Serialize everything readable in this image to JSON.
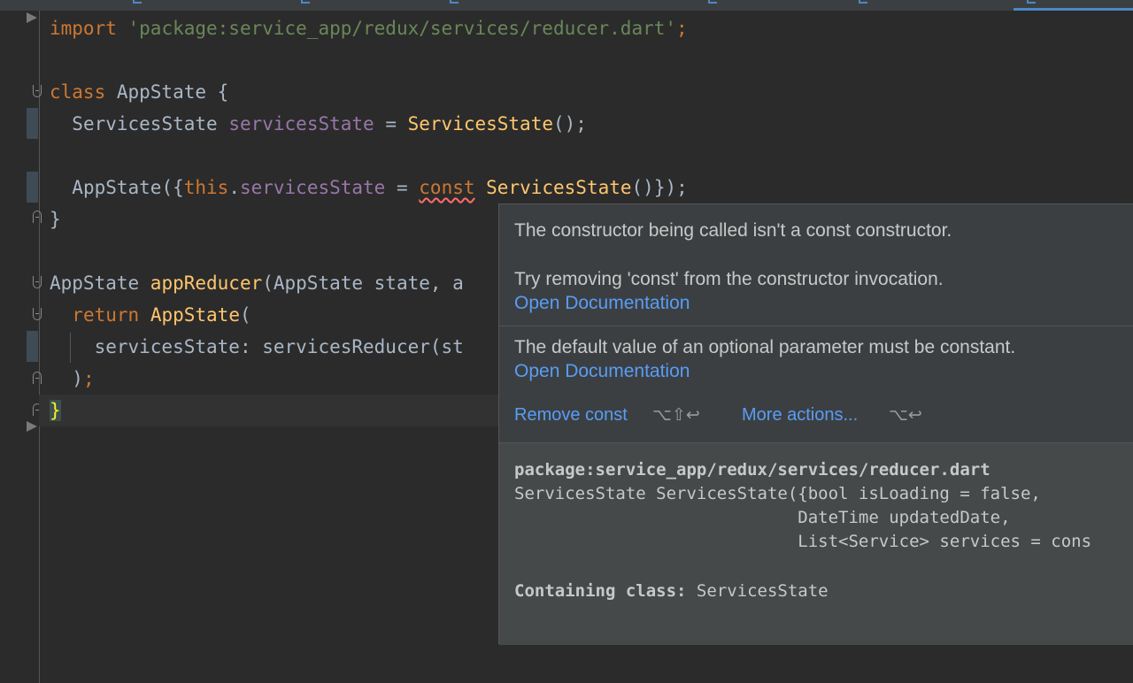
{
  "editor": {
    "lines": {
      "l1": {
        "import_kw": "import",
        "path": "'package:service_app/redux/services/reducer.dart'",
        "semi": ";"
      },
      "l3": {
        "class_kw": "class",
        "rest": " AppState {"
      },
      "l4": {
        "type": "ServicesState ",
        "field": "servicesState",
        "eq": " = ",
        "ctor": "ServicesState",
        "end": "();"
      },
      "l6": {
        "name": "AppState({",
        "this_kw": "this",
        "dot": ".",
        "field": "servicesState",
        "eq": " = ",
        "const_kw": "const",
        "sp": " ",
        "ctor": "ServicesState",
        "end": "()});"
      },
      "l7": {
        "text": "}"
      },
      "l9": {
        "type": "AppState ",
        "fn": "appReducer",
        "rest": "(AppState state, a"
      },
      "l10": {
        "ret_kw": "return",
        "sp": " ",
        "ctor": "AppState",
        "paren": "("
      },
      "l11": {
        "text": "servicesState: servicesReducer(st"
      },
      "l12": {
        "paren": ")",
        "semi": ";"
      },
      "l13": {
        "text": "}"
      }
    }
  },
  "popup": {
    "error1": "The constructor being called isn't a const constructor.",
    "hint1": "Try removing 'const' from the constructor invocation.",
    "doc_link1": "Open Documentation",
    "error2": "The default value of an optional parameter must be constant.",
    "doc_link2": "Open Documentation",
    "action1": "Remove const",
    "action1_shortcut": "⌥⇧↩",
    "action2": "More actions...",
    "action2_shortcut": "⌥↩",
    "doc": {
      "package": "package:service_app/redux/services/reducer.dart",
      "sig1": "ServicesState ServicesState({bool isLoading = false,",
      "sig2": "                            DateTime updatedDate,",
      "sig3": "                            List<Service> services = cons",
      "containing_label": "Containing class:",
      "containing_value": " ServicesState"
    }
  },
  "colors": {
    "background": "#2b2b2b",
    "keyword": "#cc7832",
    "string": "#6a8759",
    "field": "#9876aa",
    "function": "#ffc66d",
    "link": "#589df6",
    "popup_bg": "#3c3f41"
  }
}
